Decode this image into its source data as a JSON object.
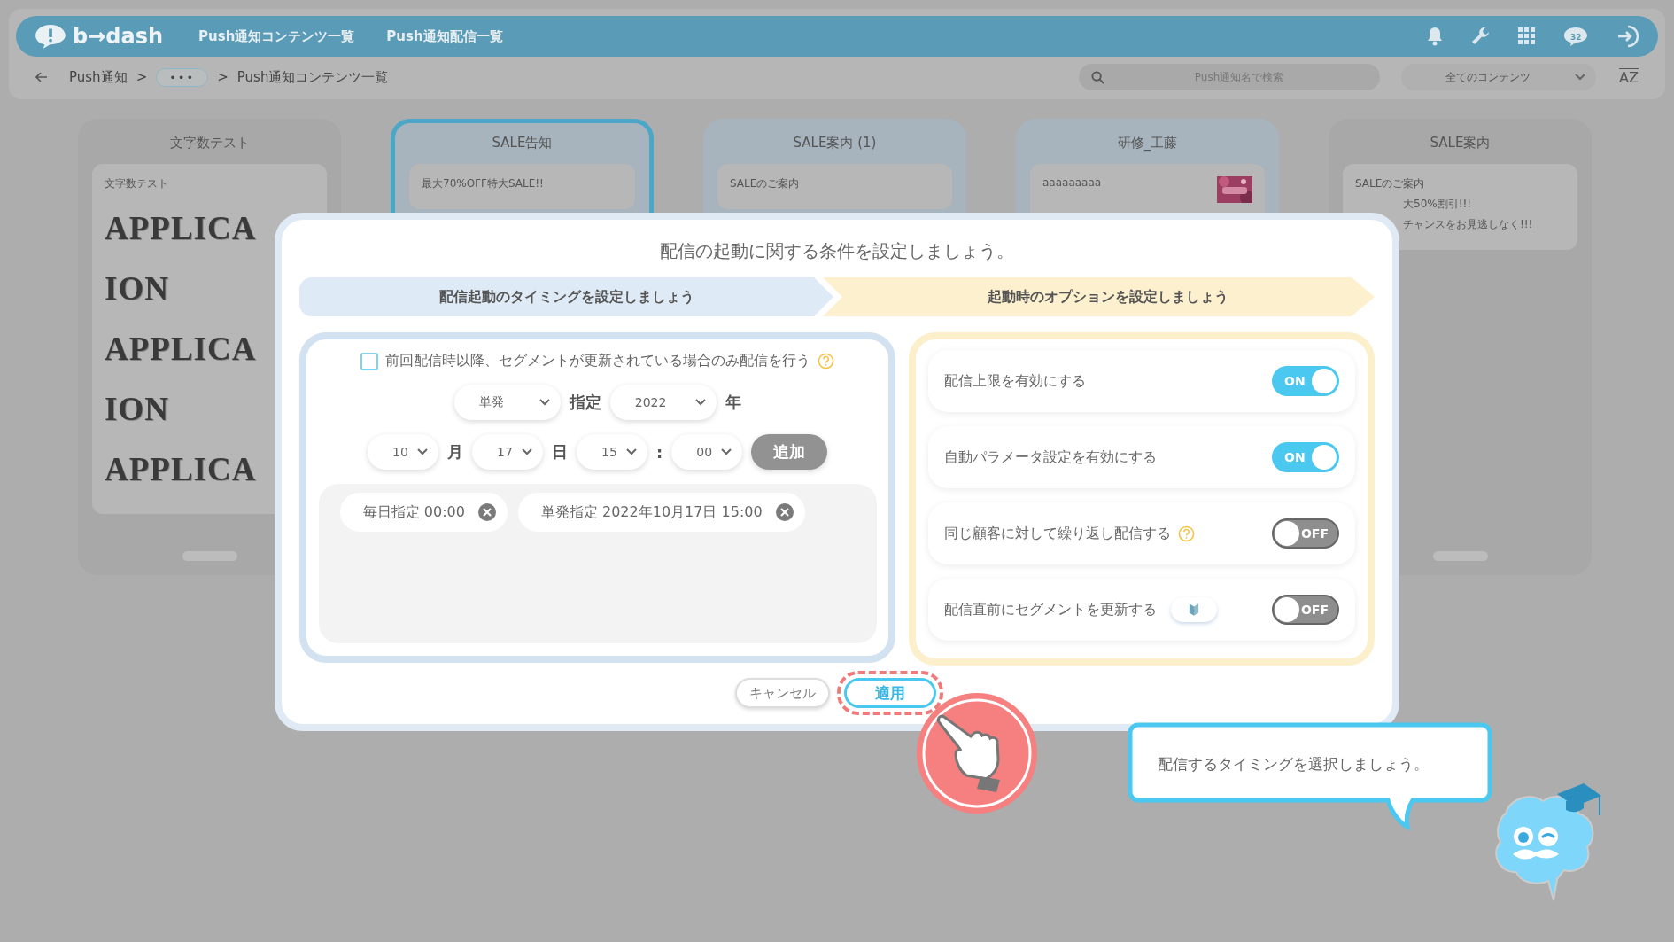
{
  "header": {
    "logo": "b→dash",
    "nav": [
      {
        "label": "Push通知コンテンツ一覧"
      },
      {
        "label": "Push通知配信一覧"
      }
    ],
    "badge": "32"
  },
  "breadcrumb": [
    {
      "kind": "link",
      "label": "Push通知"
    },
    {
      "kind": "sep",
      "label": ">"
    },
    {
      "kind": "more",
      "label": "•••"
    },
    {
      "kind": "sep",
      "label": ">"
    },
    {
      "kind": "current",
      "label": "Push通知コンテンツ一覧"
    }
  ],
  "search": {
    "placeholder": "Push通知名で検索"
  },
  "filter": {
    "value": "全てのコンテンツ"
  },
  "sort": {
    "label": "AZ"
  },
  "cards": [
    {
      "title": "文字数テスト",
      "selected": false,
      "color": "#a8a8a8",
      "preview_title": "文字数テスト",
      "large_lines": [
        "APPLICA",
        "ION",
        "APPLICA",
        "ION",
        "APPLICA"
      ],
      "thumbnail": false
    },
    {
      "title": "SALE告知",
      "selected": true,
      "color": "#a7b4bd",
      "preview_title": "最大70%OFF特大SALE!!",
      "thumbnail": false
    },
    {
      "title": "SALE案内 (1)",
      "selected": false,
      "color": "#a7b4bd",
      "preview_title": "SALEのご案内",
      "thumbnail": false
    },
    {
      "title": "研修_工藤",
      "selected": false,
      "color": "#a7b4bd",
      "preview_title": "aaaaaaaaa",
      "thumbnail": true
    },
    {
      "title": "SALE案内",
      "selected": false,
      "color": "#a8a8a8",
      "preview_title": "SALEのご案内",
      "preview_lines": [
        "大50%割引!!!",
        "チャンスをお見逃しなく!!!"
      ],
      "thumbnail": false
    }
  ],
  "dialog": {
    "title": "配信の起動に関する条件を設定しましょう。",
    "steps": [
      {
        "label": "配信起動のタイミングを設定しましょう",
        "color": "#deeaf5"
      },
      {
        "label": "起動時のオプションを設定しましょう",
        "color": "#fcf0cf"
      }
    ],
    "timing": {
      "condition": {
        "label": "前回配信時以降、セグメントが更新されている場合のみ配信を行う",
        "checked": false
      },
      "type_select": "単発",
      "type_suffix": "指定",
      "year_select": "2022",
      "year_unit": "年",
      "month_select": "10",
      "month_unit": "月",
      "day_select": "17",
      "day_unit": "日",
      "hour_select": "15",
      "time_separator": ":",
      "minute_select": "00",
      "add_button": {
        "label": "追加",
        "disabled": true
      },
      "schedules": [
        {
          "label": "毎日指定 00:00"
        },
        {
          "label": "単発指定 2022年10月17日 15:00"
        }
      ]
    },
    "options": [
      {
        "label": "配信上限を有効にする",
        "on": true,
        "toggle_label": "ON",
        "help": false,
        "beginner_badge": false
      },
      {
        "label": "自動パラメータ設定を有効にする",
        "on": true,
        "toggle_label": "ON",
        "help": false,
        "beginner_badge": false
      },
      {
        "label": "同じ顧客に対して繰り返し配信する",
        "on": false,
        "toggle_label": "OFF",
        "help": true,
        "beginner_badge": false
      },
      {
        "label": "配信直前にセグメントを更新する",
        "on": false,
        "toggle_label": "OFF",
        "help": false,
        "beginner_badge": true
      }
    ],
    "buttons": [
      {
        "label": "キャンセル",
        "kind": "secondary",
        "highlighted": false
      },
      {
        "label": "適用",
        "kind": "primary",
        "highlighted": true
      }
    ]
  },
  "tutorial": {
    "message": "配信するタイミングを選択しましょう。"
  }
}
